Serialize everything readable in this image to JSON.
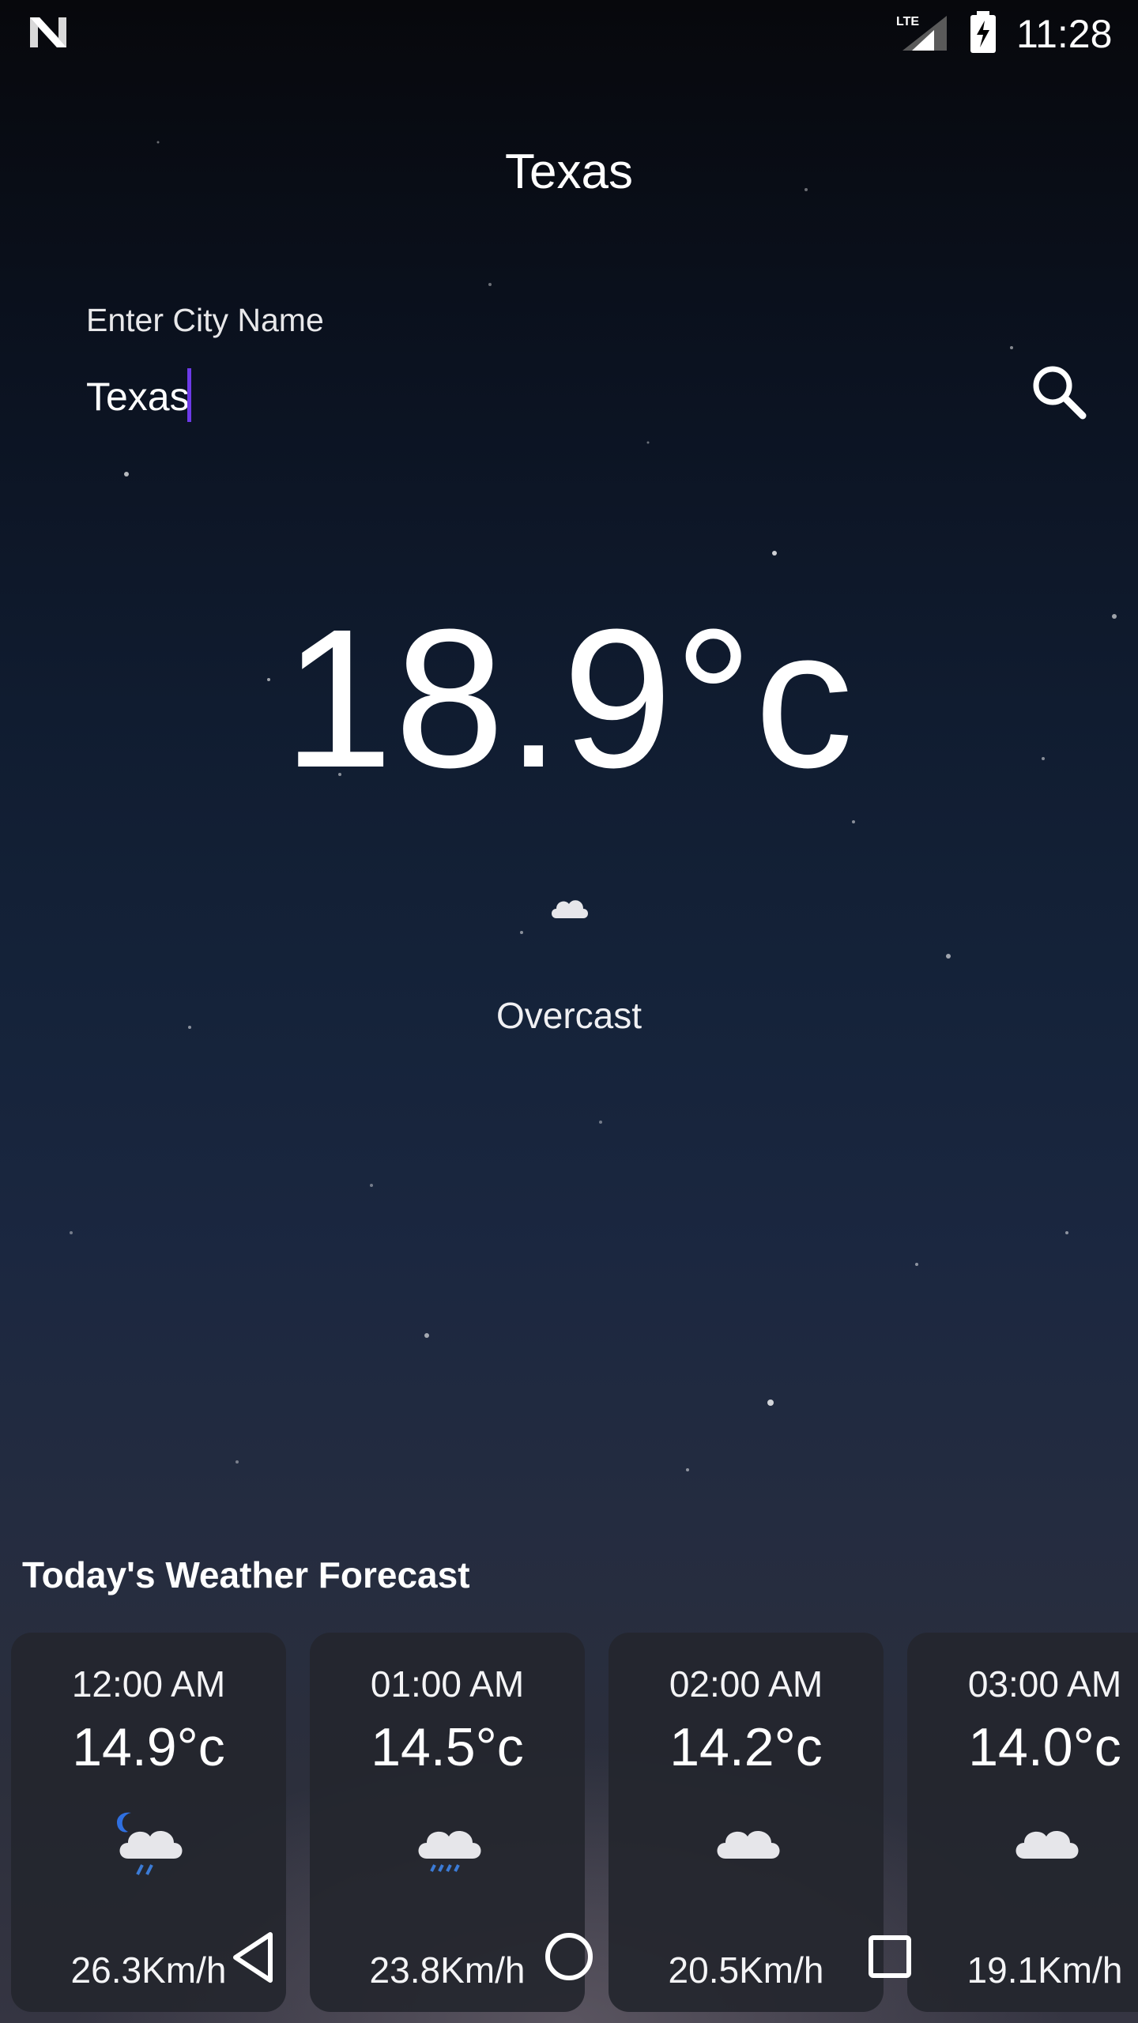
{
  "status_bar": {
    "time": "11:28",
    "network": "LTE",
    "icons": [
      "n-logo-icon",
      "lte-signal-icon",
      "battery-charging-icon"
    ]
  },
  "header": {
    "title": "Texas"
  },
  "search": {
    "label": "Enter City Name",
    "value": "Texas",
    "icon": "search-icon"
  },
  "current": {
    "temperature": "18.9°c",
    "condition": "Overcast",
    "icon": "cloud-icon"
  },
  "forecast": {
    "title": "Today's Weather Forecast",
    "items": [
      {
        "time": "12:00 AM",
        "temp": "14.9°c",
        "wind": "26.3Km/h",
        "icon": "night-rain-icon"
      },
      {
        "time": "01:00 AM",
        "temp": "14.5°c",
        "wind": "23.8Km/h",
        "icon": "rain-cloud-icon"
      },
      {
        "time": "02:00 AM",
        "temp": "14.2°c",
        "wind": "20.5Km/h",
        "icon": "cloud-icon"
      },
      {
        "time": "03:00 AM",
        "temp": "14.0°c",
        "wind": "19.1Km/h",
        "icon": "cloud-icon"
      }
    ]
  },
  "colors": {
    "accent_caret": "#6d3ae8",
    "card_bg": "#24262e",
    "text": "#ffffff",
    "rain_drop": "#3b7bd6",
    "moon": "#2f6fe0"
  },
  "navigation": {
    "icons": [
      "back-icon",
      "home-icon",
      "recents-icon"
    ]
  }
}
